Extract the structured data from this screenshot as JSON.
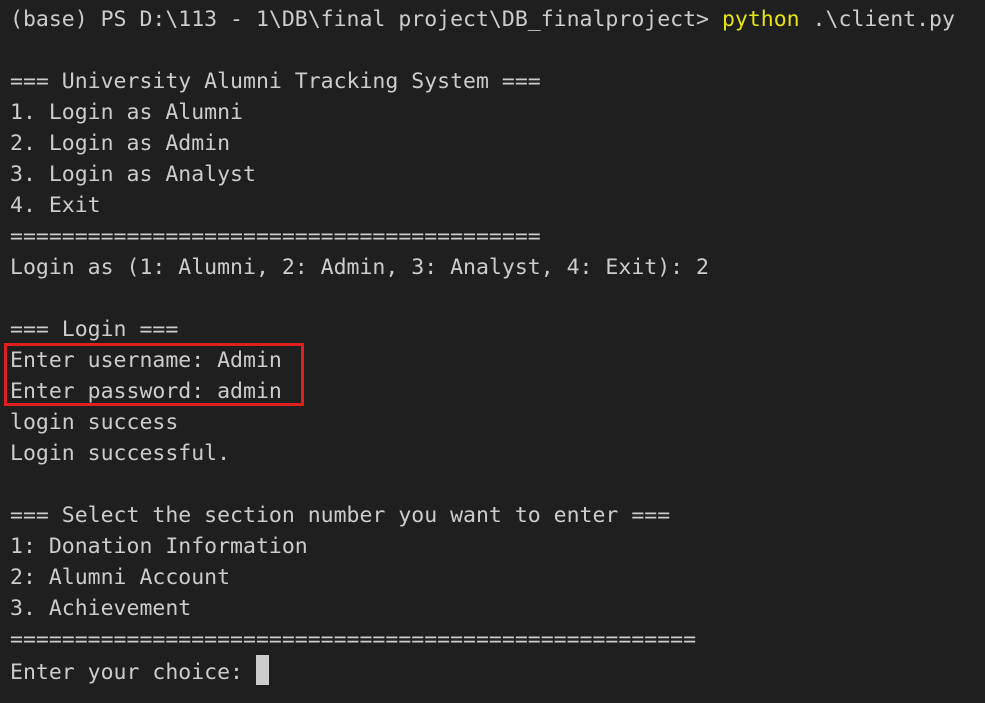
{
  "prompt": {
    "path": "(base) PS D:\\113 - 1\\DB\\final project\\DB_finalproject> ",
    "command": "python",
    "args": " .\\client.py"
  },
  "menu": {
    "title": "=== University Alumni Tracking System ===",
    "options": [
      "1. Login as Alumni",
      "2. Login as Admin",
      "3. Login as Analyst",
      "4. Exit"
    ],
    "separator": "=========================================",
    "login_prompt": "Login as (1: Alumni, 2: Admin, 3: Analyst, 4: Exit): 2"
  },
  "login": {
    "title": "=== Login ===",
    "username_line": "Enter username: Admin",
    "password_line": "Enter password: admin",
    "status_1": "login success",
    "status_2": "Login successful."
  },
  "section": {
    "title": "=== Select the section number you want to enter ===",
    "options": [
      "1: Donation Information",
      "2: Alumni Account",
      "3. Achievement"
    ],
    "separator": "=====================================================",
    "choice_prompt": "Enter your choice: "
  },
  "colors": {
    "background": "#1f1f1f",
    "text": "#cccccc",
    "command": "#e5e510",
    "highlight_box": "#e01f1f"
  }
}
